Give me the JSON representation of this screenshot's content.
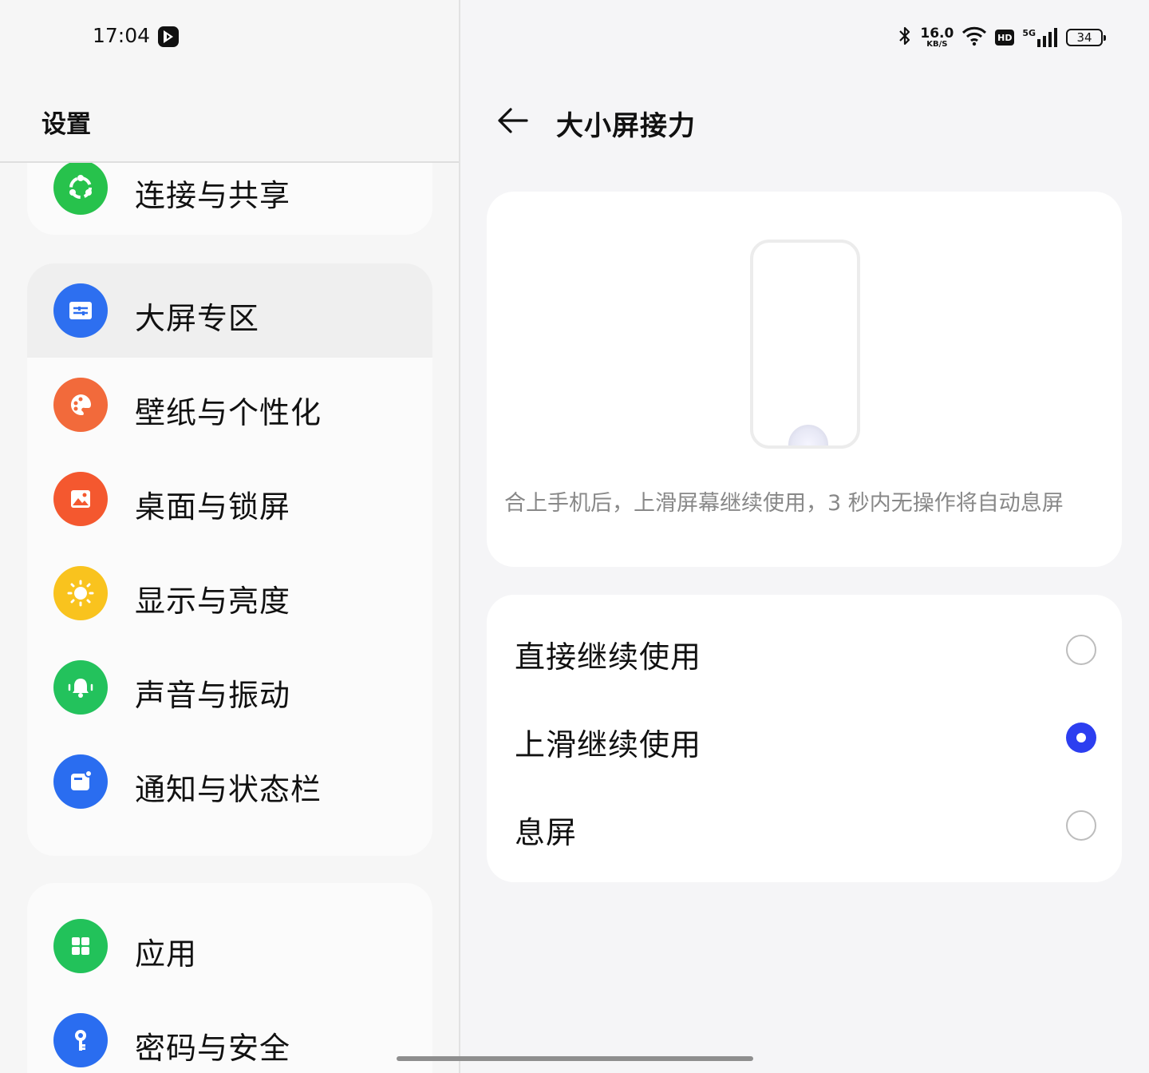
{
  "status_bar": {
    "time": "17:04",
    "network_speed_value": "16.0",
    "network_speed_unit": "KB/S",
    "hd_label": "HD",
    "signal_label": "5G",
    "battery_level": "34",
    "icons": [
      "bluetooth-icon",
      "wifi-icon",
      "hd-icon",
      "cellular-signal-icon",
      "battery-icon",
      "app-notification-icon"
    ]
  },
  "left_pane": {
    "title": "设置",
    "groups": [
      {
        "items": [
          {
            "label": "连接与共享",
            "icon": "share-icon",
            "color": "#27c24c"
          }
        ]
      },
      {
        "items": [
          {
            "label": "大屏专区",
            "icon": "large-screen-icon",
            "color": "#2d6ff0",
            "selected": true
          },
          {
            "label": "壁纸与个性化",
            "icon": "palette-icon",
            "color": "#f26a3b"
          },
          {
            "label": "桌面与锁屏",
            "icon": "picture-icon",
            "color": "#f4582f"
          },
          {
            "label": "显示与亮度",
            "icon": "sun-icon",
            "color": "#f9c31e"
          },
          {
            "label": "声音与振动",
            "icon": "bell-icon",
            "color": "#23c25c"
          },
          {
            "label": "通知与状态栏",
            "icon": "notification-icon",
            "color": "#2a6df0"
          }
        ]
      },
      {
        "items": [
          {
            "label": "应用",
            "icon": "apps-grid-icon",
            "color": "#22c25a"
          },
          {
            "label": "密码与安全",
            "icon": "key-icon",
            "color": "#2a6df0"
          }
        ]
      }
    ]
  },
  "right_pane": {
    "title": "大小屏接力",
    "description": "合上手机后，上滑屏幕继续使用，3 秒内无操作将自动息屏",
    "options": [
      {
        "label": "直接继续使用",
        "selected": false
      },
      {
        "label": "上滑继续使用",
        "selected": true
      },
      {
        "label": "息屏",
        "selected": false
      }
    ],
    "accent_color": "#2c3ef0"
  }
}
